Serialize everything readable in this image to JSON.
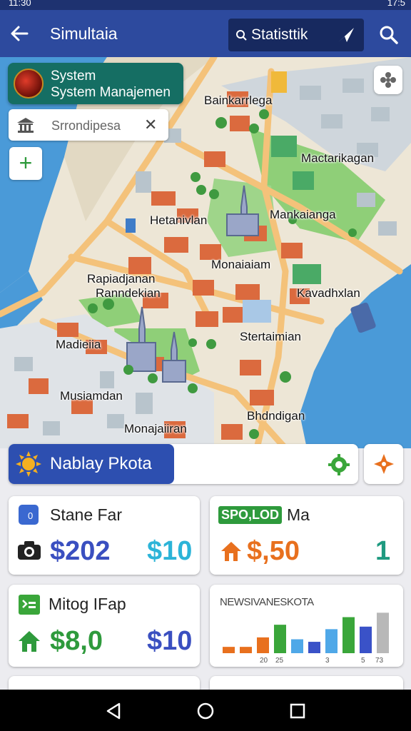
{
  "status": {
    "time": "11:30",
    "right_time": "17:5"
  },
  "appbar": {
    "title": "Simultaia",
    "stat_button": "Statisttik"
  },
  "map": {
    "system_card": {
      "line1": "System",
      "line2": "System Manajemen"
    },
    "location_card": {
      "text": "Srrondipesa"
    },
    "labels": [
      "Bainkarrlega",
      "Mactarikagan",
      "Hetanivlan",
      "Mankaianga",
      "Monaiaiam",
      "Rapiadjanan",
      "Ranndekian",
      "Kavadhxlan",
      "Madieiia",
      "Stertaimian",
      "Musiamdan",
      "Monajaiiran",
      "Bhdndigan"
    ]
  },
  "banner": {
    "title": "Nablay Pkota"
  },
  "cards": {
    "c1": {
      "label": "Stane Far",
      "value_main": "$202",
      "value_side": "$10"
    },
    "c2": {
      "badge": "SPO,LOD",
      "label": "Ma",
      "value_main": "$,50",
      "value_side": "1"
    },
    "c3": {
      "label": "Mitog IFap",
      "value_main": "$8,0",
      "value_side": "$10"
    },
    "c4": {
      "chart_title": "NEWSIVANESKOTA"
    }
  },
  "chart_data": {
    "type": "bar",
    "title": "NEWSIVANESKOTA",
    "tick_labels": [
      "20",
      "25",
      "3",
      "5",
      "73"
    ],
    "values": [
      1,
      1,
      2.5,
      4.5,
      2.2,
      1.8,
      3.8,
      5.7,
      4.2,
      6.4
    ],
    "colors": [
      "#e8701e",
      "#e8701e",
      "#e8701e",
      "#3aa63a",
      "#4fa8e8",
      "#3a52c8",
      "#4fa8e8",
      "#3aa63a",
      "#3a52c8",
      "#b8b8b8"
    ],
    "ylim": [
      0,
      7
    ]
  },
  "colors": {
    "appbar": "#2d4a9e",
    "accent_green": "#2e9a3c",
    "accent_orange": "#e8701e",
    "blue_value": "#3a4fc0",
    "cyan_value": "#2cb4d8"
  }
}
